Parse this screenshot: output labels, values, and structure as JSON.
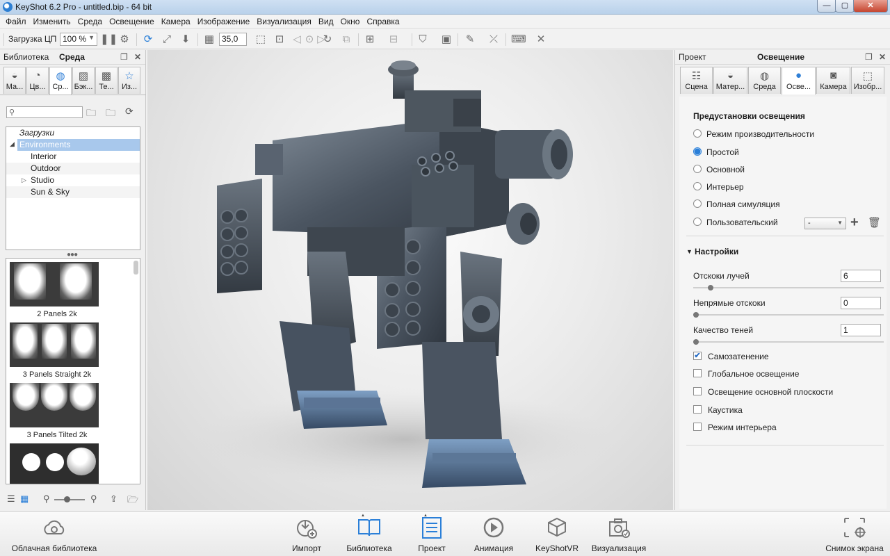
{
  "window": {
    "title": "KeyShot 6.2 Pro  -  untitled.bip  -  64 bit",
    "minimize": "—",
    "maximize": "▢",
    "close": "✕"
  },
  "menu": [
    "Файл",
    "Изменить",
    "Среда",
    "Освещение",
    "Камера",
    "Изображение",
    "Визуализация",
    "Вид",
    "Окно",
    "Справка"
  ],
  "toolbar": {
    "cpu_label": "Загрузка ЦП",
    "cpu_value": "100 %",
    "fov_value": "35,0"
  },
  "left_panel": {
    "tab_library": "Библиотека",
    "tab_environment": "Среда",
    "tabs": [
      {
        "label": "Ма...",
        "icon": "materials-icon"
      },
      {
        "label": "Цв...",
        "icon": "colors-icon"
      },
      {
        "label": "Ср...",
        "icon": "environments-icon",
        "active": true
      },
      {
        "label": "Бэк...",
        "icon": "backplates-icon"
      },
      {
        "label": "Те...",
        "icon": "textures-icon"
      },
      {
        "label": "Из...",
        "icon": "favorites-icon"
      }
    ],
    "search_placeholder": "",
    "tree": [
      {
        "label": "Загрузки",
        "indent": 0,
        "italic": true
      },
      {
        "label": "Environments",
        "indent": 0,
        "selected": true,
        "expanded": true
      },
      {
        "label": "Interior",
        "indent": 1
      },
      {
        "label": "Outdoor",
        "indent": 1
      },
      {
        "label": "Studio",
        "indent": 1,
        "collapsed": true
      },
      {
        "label": "Sun & Sky",
        "indent": 1
      }
    ],
    "thumbnails": [
      {
        "caption": "2 Panels 2k"
      },
      {
        "caption": "3 Panels Straight 2k"
      },
      {
        "caption": "3 Panels Tilted 2k"
      },
      {
        "caption": ""
      }
    ]
  },
  "right_panel": {
    "tab_project": "Проект",
    "tab_lighting": "Освещение",
    "tabs": [
      {
        "label": "Сцена",
        "icon": "scene-icon"
      },
      {
        "label": "Матер...",
        "icon": "material-icon"
      },
      {
        "label": "Среда",
        "icon": "environment-icon"
      },
      {
        "label": "Осве...",
        "icon": "lighting-icon",
        "active": true
      },
      {
        "label": "Камера",
        "icon": "camera-icon"
      },
      {
        "label": "Изобр...",
        "icon": "image-icon"
      }
    ],
    "presets_title": "Предустановки освещения",
    "presets": [
      {
        "label": "Режим производительности",
        "selected": false
      },
      {
        "label": "Простой",
        "selected": true
      },
      {
        "label": "Основной",
        "selected": false
      },
      {
        "label": "Интерьер",
        "selected": false
      },
      {
        "label": "Полная симуляция",
        "selected": false
      },
      {
        "label": "Пользовательский",
        "selected": false
      }
    ],
    "custom_select_value": "-",
    "settings_title": "Настройки",
    "params": [
      {
        "label": "Отскоки лучей",
        "value": "6",
        "level": 0.09
      },
      {
        "label": "Непрямые отскоки",
        "value": "0",
        "level": 0.0
      },
      {
        "label": "Качество теней",
        "value": "1",
        "level": 0.0
      }
    ],
    "checks": [
      {
        "label": "Самозатенение",
        "checked": true
      },
      {
        "label": "Глобальное освещение",
        "checked": false
      },
      {
        "label": "Освещение основной плоскости",
        "checked": false
      },
      {
        "label": "Каустика",
        "checked": false
      },
      {
        "label": "Режим интерьера",
        "checked": false
      }
    ]
  },
  "ribbon": {
    "cloud": "Облачная библиотека",
    "import": "Импорт",
    "library": "Библиотека",
    "project": "Проект",
    "animation": "Анимация",
    "keyshotvr": "KeyShotVR",
    "render": "Визуализация",
    "screenshot": "Снимок экрана"
  },
  "colors": {
    "accent": "#2a7fd8",
    "selection": "#a8c8ec"
  }
}
